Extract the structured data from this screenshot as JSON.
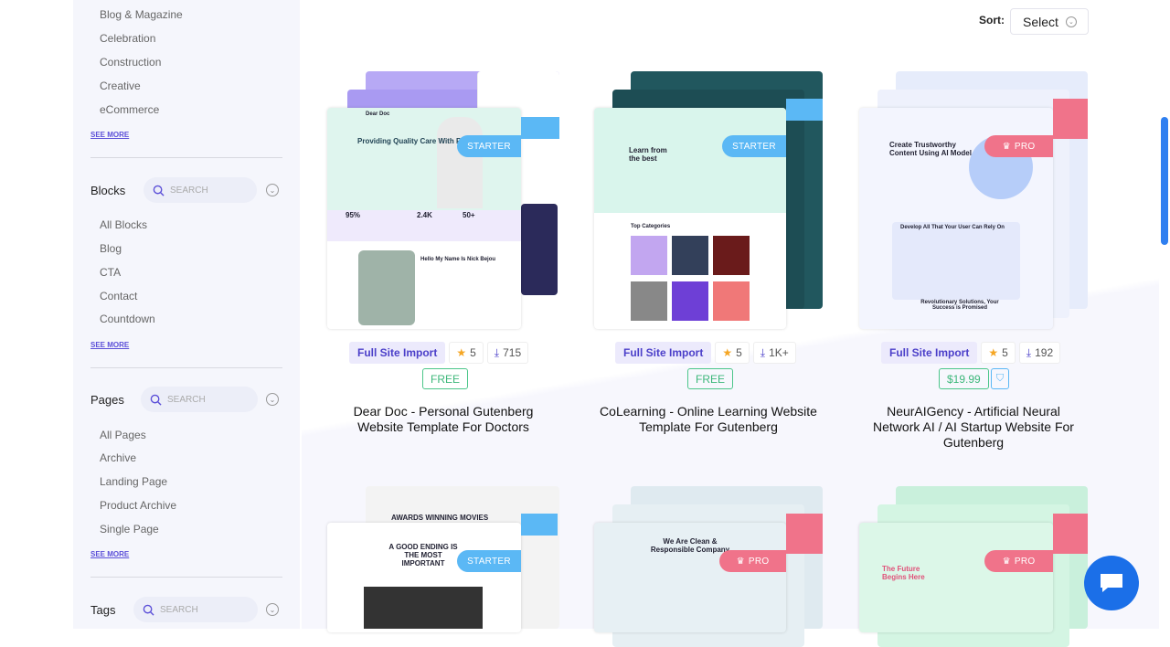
{
  "sidebar": {
    "categories": [
      "Blog & Magazine",
      "Celebration",
      "Construction",
      "Creative",
      "eCommerce"
    ],
    "see_more": "SEE MORE",
    "blocks": {
      "title": "Blocks",
      "placeholder": "SEARCH",
      "items": [
        "All Blocks",
        "Blog",
        "CTA",
        "Contact",
        "Countdown"
      ]
    },
    "pages": {
      "title": "Pages",
      "placeholder": "SEARCH",
      "items": [
        "All Pages",
        "Archive",
        "Landing Page",
        "Product Archive",
        "Single Page"
      ]
    },
    "tags": {
      "title": "Tags",
      "placeholder": "SEARCH"
    }
  },
  "sort": {
    "label": "Sort:",
    "value": "Select"
  },
  "cards": [
    {
      "badge": "STARTER",
      "import": "Full Site Import",
      "rating": "5",
      "downloads": "715",
      "price": "FREE",
      "title": "Dear Doc - Personal Gutenberg Website Template For Doctors",
      "preview": {
        "brand": "Dear Doc",
        "headline": "Providing Quality Care With Patient",
        "stat1": "95%",
        "stat2": "2.4K",
        "stat3": "50+",
        "sub": "Hello My Name Is Nick Bejou"
      }
    },
    {
      "badge": "STARTER",
      "import": "Full Site Import",
      "rating": "5",
      "downloads": "1K+",
      "price": "FREE",
      "title": "CoLearning - Online Learning Website Template For Gutenberg",
      "preview": {
        "headline": "Learn from the best",
        "sub": "Top Categories"
      }
    },
    {
      "badge": "PRO",
      "import": "Full Site Import",
      "rating": "5",
      "downloads": "192",
      "price": "$19.99",
      "title": "NeurAIGency - Artificial Neural Network AI / AI Startup Website For Gutenberg",
      "preview": {
        "headline": "Create Trustworthy Content Using AI Model",
        "sub": "Develop All That Your User Can Rely On",
        "sub2": "Revolutionary Solutions, Your Success is Promised"
      }
    },
    {
      "badge": "STARTER",
      "preview": {
        "headline": "AWARDS WINNING MOVIES",
        "sub": "A GOOD ENDING IS THE MOST IMPORTANT"
      }
    },
    {
      "badge": "PRO",
      "preview": {
        "headline": "We Are Clean & Responsible Company"
      }
    },
    {
      "badge": "PRO",
      "preview": {
        "headline": "The Future Begins Here"
      }
    }
  ],
  "colors": {
    "accent": "#4b3fc9",
    "starter": "#5bb8f5",
    "pro": "#f0738a",
    "free": "#3cb77a",
    "chat": "#1b6fe8"
  }
}
